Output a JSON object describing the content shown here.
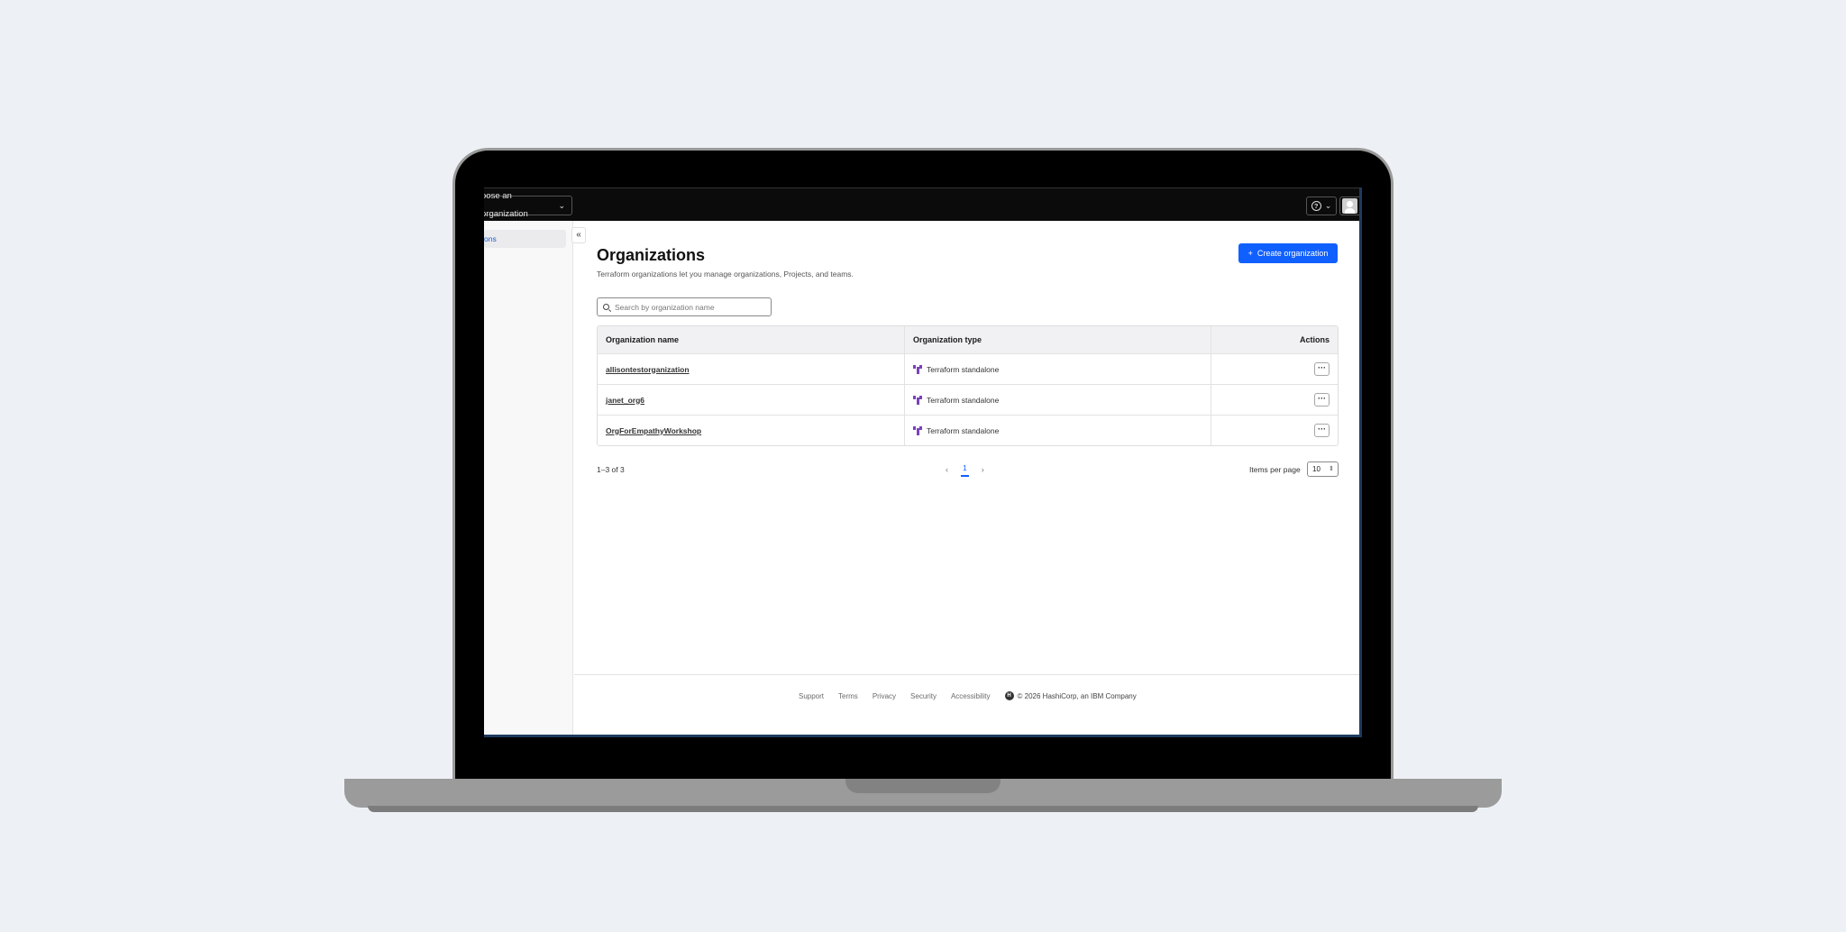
{
  "topbar": {
    "org_picker_label": "oose an organization",
    "help_chevron": "⌄",
    "user_chevron": "⌄"
  },
  "sidebar": {
    "active_item": "ons",
    "collapse_glyph": "«"
  },
  "main": {
    "title": "Organizations",
    "subtitle": "Terraform organizations let you manage organizations, Projects, and teams.",
    "create_button": "Create organization",
    "search_placeholder": "Search by organization name"
  },
  "table": {
    "headers": [
      "Organization name",
      "Organization type",
      "Actions"
    ],
    "rows": [
      {
        "name": "allisontestorganization",
        "type": "Terraform standalone"
      },
      {
        "name": "janet_org6",
        "type": "Terraform standalone"
      },
      {
        "name": "OrgForEmpathyWorkshop",
        "type": "Terraform standalone"
      }
    ],
    "more_glyph": "···"
  },
  "pagination": {
    "range": "1–3 of 3",
    "current_page": "1",
    "prev_glyph": "‹",
    "next_glyph": "›",
    "per_page_label": "Items per page",
    "per_page_value": "10"
  },
  "footer": {
    "links": [
      "Support",
      "Terms",
      "Privacy",
      "Security",
      "Accessibility"
    ],
    "copyright": "© 2026 HashiCorp, an IBM Company"
  },
  "colors": {
    "primary": "#1060ff",
    "terraform_purple": "#7b42bc",
    "topbar": "#0b0b0b"
  }
}
